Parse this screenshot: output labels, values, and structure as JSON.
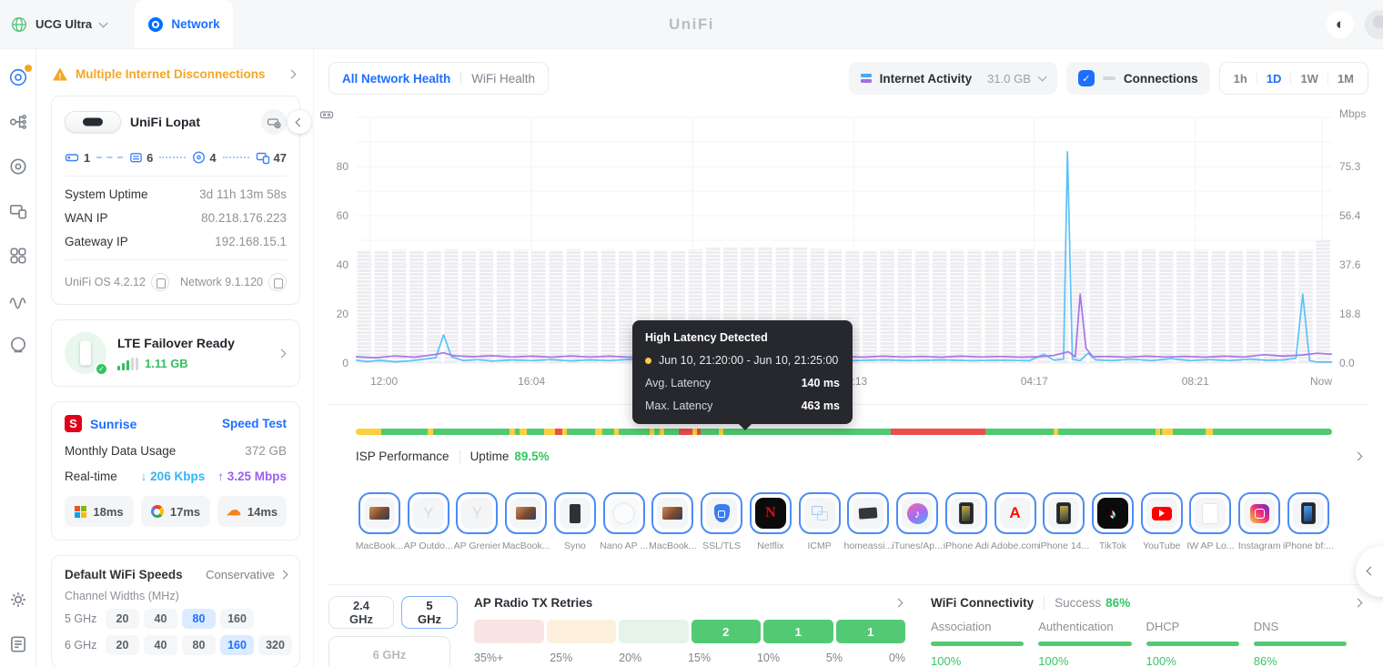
{
  "topbar": {
    "console_name": "UCG Ultra",
    "tab_label": "Network",
    "brand": "UniFi"
  },
  "sidebar": {
    "items": [
      "dashboard",
      "topology",
      "unifi-devices",
      "clients",
      "applications",
      "statistics",
      "radios",
      "settings",
      "system-log"
    ]
  },
  "left_panel": {
    "alert_label": "Multiple Internet Disconnections",
    "gateway_card": {
      "name": "UniFi Lopat",
      "topology": [
        {
          "type": "gateway",
          "count": "1"
        },
        {
          "type": "switch",
          "count": "6"
        },
        {
          "type": "access-point",
          "count": "4"
        },
        {
          "type": "clients",
          "count": "47"
        }
      ],
      "info_rows": [
        {
          "label": "System Uptime",
          "value": "3d 11h 13m 58s"
        },
        {
          "label": "WAN IP",
          "value": "80.218.176.223"
        },
        {
          "label": "Gateway IP",
          "value": "192.168.15.1"
        }
      ],
      "firmware": [
        {
          "label": "UniFi OS 4.2.12"
        },
        {
          "label": "Network 9.1.120"
        }
      ]
    },
    "lte_card": {
      "title": "LTE Failover Ready",
      "usage": "1.11 GB"
    },
    "isp_card": {
      "provider": "Sunrise",
      "speed_test_label": "Speed Test",
      "usage_label": "Monthly Data Usage",
      "usage_value": "372 GB",
      "realtime_label": "Real-time",
      "download": "206 Kbps",
      "upload": "3.25 Mbps",
      "pings": [
        {
          "provider": "Microsoft",
          "latency": "18ms"
        },
        {
          "provider": "Google",
          "latency": "17ms"
        },
        {
          "provider": "Cloudflare",
          "latency": "14ms"
        }
      ]
    },
    "wifi_card": {
      "title": "Default WiFi Speeds",
      "mode": "Conservative",
      "subtitle": "Channel Widths (MHz)",
      "rows": [
        {
          "band": "5 GHz",
          "options": [
            "20",
            "40",
            "80",
            "160"
          ],
          "selected": "80"
        },
        {
          "band": "6 GHz",
          "options": [
            "20",
            "40",
            "80",
            "160",
            "320"
          ],
          "selected": "160"
        }
      ]
    }
  },
  "main": {
    "health_tabs": [
      {
        "label": "All Network Health",
        "active": true
      },
      {
        "label": "WiFi Health",
        "active": false
      }
    ],
    "activity": {
      "label": "Internet Activity",
      "value": "31.0 GB"
    },
    "connections_label": "Connections",
    "ranges": [
      {
        "label": "1h"
      },
      {
        "label": "1D",
        "active": true
      },
      {
        "label": "1W"
      },
      {
        "label": "1M"
      }
    ],
    "tooltip": {
      "title": "High Latency Detected",
      "period": "Jun 10, 21:20:00 - Jun 10, 21:25:00",
      "rows": [
        {
          "label": "Avg. Latency",
          "value": "140 ms"
        },
        {
          "label": "Max. Latency",
          "value": "463 ms"
        }
      ]
    },
    "isp": {
      "label": "ISP Performance",
      "uptime_label": "Uptime",
      "uptime_value": "89.5%",
      "colors": {
        "g": "#4ecb71",
        "y": "#fccf3e",
        "r": "#ee4d4d"
      },
      "segments": [
        [
          "y",
          29
        ],
        [
          "g",
          52
        ],
        [
          "y",
          7
        ],
        [
          "g",
          86
        ],
        [
          "y",
          6
        ],
        [
          "g",
          6
        ],
        [
          "y",
          8
        ],
        [
          "g",
          19
        ],
        [
          "y",
          13
        ],
        [
          "r",
          8
        ],
        [
          "y",
          5
        ],
        [
          "g",
          32
        ],
        [
          "y",
          8
        ],
        [
          "g",
          14
        ],
        [
          "y",
          5
        ],
        [
          "g",
          35
        ],
        [
          "y",
          5
        ],
        [
          "g",
          6
        ],
        [
          "y",
          5
        ],
        [
          "g",
          17
        ],
        [
          "r",
          15
        ],
        [
          "y",
          5
        ],
        [
          "r",
          5
        ],
        [
          "g",
          20
        ],
        [
          "y",
          5
        ],
        [
          "g",
          190
        ],
        [
          "r",
          107
        ],
        [
          "g",
          78
        ],
        [
          "y",
          5
        ],
        [
          "g",
          110
        ],
        [
          "y",
          5
        ],
        [
          "g",
          2
        ],
        [
          "y",
          13
        ],
        [
          "g",
          37
        ],
        [
          "y",
          8
        ],
        [
          "g",
          135
        ]
      ]
    },
    "clients": [
      {
        "name": "MacBook...",
        "type": "laptop"
      },
      {
        "name": "AP Outdo...",
        "type": "antenna"
      },
      {
        "name": "AP Grenier",
        "type": "antenna"
      },
      {
        "name": "MacBook...",
        "type": "laptop"
      },
      {
        "name": "Syno",
        "type": "nas"
      },
      {
        "name": "Nano AP ...",
        "type": "ap-nano"
      },
      {
        "name": "MacBook...",
        "type": "laptop"
      },
      {
        "name": "SSL/TLS",
        "type": "shield"
      },
      {
        "name": "Netflix",
        "type": "netflix"
      },
      {
        "name": "ICMP",
        "type": "icmp"
      },
      {
        "name": "homeassi...",
        "type": "speaker"
      },
      {
        "name": "iTunes/Ap...",
        "type": "itunes"
      },
      {
        "name": "iPhone Adi",
        "type": "iphone"
      },
      {
        "name": "Adobe.com",
        "type": "adobe"
      },
      {
        "name": "iPhone 14...",
        "type": "iphone"
      },
      {
        "name": "TikTok",
        "type": "tiktok"
      },
      {
        "name": "YouTube",
        "type": "youtube"
      },
      {
        "name": "IW AP Lo...",
        "type": "ap-white"
      },
      {
        "name": "Instagram",
        "type": "instagram"
      },
      {
        "name": "iPhone bf:...",
        "type": "iphone-blue"
      }
    ],
    "bands": [
      {
        "label": "2.4 GHz"
      },
      {
        "label": "5 GHz",
        "active": true
      },
      {
        "label": "6 GHz",
        "disabled": true
      }
    ],
    "tx_retries": {
      "title": "AP Radio TX Retries",
      "buckets": [
        {
          "tone": "red",
          "count": ""
        },
        {
          "tone": "orange",
          "count": ""
        },
        {
          "tone": "green-light",
          "count": ""
        },
        {
          "tone": "green",
          "count": "2"
        },
        {
          "tone": "green",
          "count": "1"
        },
        {
          "tone": "green",
          "count": "1"
        }
      ],
      "scale": [
        "35%+",
        "25%",
        "20%",
        "15%",
        "10%",
        "5%",
        "0%"
      ]
    },
    "wifi_connectivity": {
      "title": "WiFi Connectivity",
      "success_label": "Success",
      "success_value": "86%",
      "columns": [
        {
          "label": "Association",
          "value": "100%"
        },
        {
          "label": "Authentication",
          "value": "100%"
        },
        {
          "label": "DHCP",
          "value": "100%"
        },
        {
          "label": "DNS",
          "value": "86%"
        }
      ]
    }
  },
  "chart_data": {
    "type": "line",
    "title": "Internet Activity",
    "left_axis_ticks": [
      80,
      60,
      40,
      20,
      0
    ],
    "right_axis": {
      "label": "Mbps",
      "ticks": [
        "75.3",
        "56.4",
        "37.6",
        "18.8",
        "0.0"
      ]
    },
    "x_ticks": [
      {
        "label": "12:00",
        "pos": 0.015
      },
      {
        "label": "16:04",
        "pos": 0.18
      },
      {
        "label": "00:13",
        "pos": 0.51
      },
      {
        "label": "04:17",
        "pos": 0.695
      },
      {
        "label": "08:21",
        "pos": 0.86
      },
      {
        "label": "Now",
        "pos": 0.99
      }
    ],
    "x_gridlines": [
      0.015,
      0.18,
      0.345,
      0.51,
      0.695,
      0.86,
      0.99
    ],
    "series": [
      {
        "name": "Download",
        "color": "#5ac2f7",
        "points": [
          [
            0,
            1.2
          ],
          [
            0.012,
            0.6
          ],
          [
            0.025,
            1.1
          ],
          [
            0.04,
            0.5
          ],
          [
            0.055,
            0.9
          ],
          [
            0.07,
            1.6
          ],
          [
            0.082,
            2.2
          ],
          [
            0.09,
            11.5
          ],
          [
            0.098,
            2.6
          ],
          [
            0.11,
            1
          ],
          [
            0.125,
            1.4
          ],
          [
            0.14,
            0.8
          ],
          [
            0.16,
            1.3
          ],
          [
            0.18,
            1
          ],
          [
            0.2,
            1.4
          ],
          [
            0.22,
            0.9
          ],
          [
            0.24,
            1.3
          ],
          [
            0.26,
            1
          ],
          [
            0.28,
            1.5
          ],
          [
            0.3,
            1
          ],
          [
            0.33,
            1.2
          ],
          [
            0.36,
            1.4
          ],
          [
            0.39,
            1
          ],
          [
            0.42,
            1.3
          ],
          [
            0.45,
            1
          ],
          [
            0.48,
            1.4
          ],
          [
            0.51,
            1
          ],
          [
            0.54,
            1.3
          ],
          [
            0.57,
            1
          ],
          [
            0.6,
            1.3
          ],
          [
            0.63,
            1
          ],
          [
            0.66,
            1.2
          ],
          [
            0.69,
            1
          ],
          [
            0.705,
            3.6
          ],
          [
            0.715,
            1.2
          ],
          [
            0.725,
            1.6
          ],
          [
            0.729,
            86
          ],
          [
            0.734,
            1.6
          ],
          [
            0.742,
            1
          ],
          [
            0.75,
            4
          ],
          [
            0.758,
            1.3
          ],
          [
            0.775,
            1
          ],
          [
            0.795,
            1.6
          ],
          [
            0.815,
            1
          ],
          [
            0.835,
            1.8
          ],
          [
            0.855,
            1
          ],
          [
            0.875,
            1.4
          ],
          [
            0.895,
            1
          ],
          [
            0.915,
            1.6
          ],
          [
            0.935,
            1.1
          ],
          [
            0.95,
            1.3
          ],
          [
            0.963,
            2
          ],
          [
            0.97,
            28
          ],
          [
            0.977,
            1
          ],
          [
            0.985,
            0.4
          ],
          [
            1,
            0.4
          ]
        ]
      },
      {
        "name": "Upload",
        "color": "#a873ea",
        "points": [
          [
            0,
            2.6
          ],
          [
            0.02,
            2.2
          ],
          [
            0.04,
            2.9
          ],
          [
            0.06,
            2.4
          ],
          [
            0.08,
            3.4
          ],
          [
            0.09,
            4.2
          ],
          [
            0.1,
            3
          ],
          [
            0.12,
            2.6
          ],
          [
            0.14,
            3
          ],
          [
            0.16,
            2.5
          ],
          [
            0.18,
            2.8
          ],
          [
            0.2,
            2.4
          ],
          [
            0.22,
            2.9
          ],
          [
            0.24,
            2.5
          ],
          [
            0.26,
            2.8
          ],
          [
            0.28,
            2.4
          ],
          [
            0.3,
            2.7
          ],
          [
            0.32,
            2.5
          ],
          [
            0.34,
            2.9
          ],
          [
            0.36,
            2.5
          ],
          [
            0.38,
            2.8
          ],
          [
            0.4,
            2.5
          ],
          [
            0.42,
            2.7
          ],
          [
            0.44,
            2.4
          ],
          [
            0.46,
            2.8
          ],
          [
            0.48,
            2.5
          ],
          [
            0.5,
            2.7
          ],
          [
            0.52,
            2.4
          ],
          [
            0.54,
            2.8
          ],
          [
            0.56,
            2.5
          ],
          [
            0.58,
            2.7
          ],
          [
            0.6,
            2.4
          ],
          [
            0.62,
            2.8
          ],
          [
            0.64,
            2.5
          ],
          [
            0.66,
            2.7
          ],
          [
            0.68,
            2.4
          ],
          [
            0.7,
            2.6
          ],
          [
            0.715,
            3.1
          ],
          [
            0.73,
            4.6
          ],
          [
            0.737,
            2.5
          ],
          [
            0.742,
            28
          ],
          [
            0.748,
            6
          ],
          [
            0.755,
            2.6
          ],
          [
            0.77,
            2.7
          ],
          [
            0.79,
            2.4
          ],
          [
            0.81,
            2.8
          ],
          [
            0.83,
            2.5
          ],
          [
            0.85,
            2.7
          ],
          [
            0.87,
            2.4
          ],
          [
            0.89,
            2.8
          ],
          [
            0.91,
            2.5
          ],
          [
            0.93,
            3.4
          ],
          [
            0.95,
            2.8
          ],
          [
            0.97,
            3.3
          ],
          [
            0.985,
            4
          ],
          [
            1,
            3.6
          ]
        ]
      }
    ],
    "connections": {
      "color": "#ededf1",
      "values": [
        46,
        45.5,
        46.2,
        45.8,
        46,
        46.3,
        45.7,
        46.1,
        45.9,
        46.2,
        45.8,
        46,
        46.4,
        45.9,
        46.1,
        45.8,
        46.2,
        46,
        45.8,
        46.3,
        47,
        47.4,
        47.2,
        47.5,
        47.3,
        47,
        46.6,
        46.2,
        46,
        45.8,
        46.1,
        46.3,
        46,
        45.8,
        46.1,
        46.2,
        45.9,
        46.1,
        46.3,
        46,
        45.9,
        46.2,
        46,
        45.8,
        46.1,
        46.3,
        46,
        45.9,
        46.2,
        46,
        45.9,
        46.2,
        46.1,
        45.9,
        46.2,
        50
      ]
    },
    "event": {
      "label": "High Latency Detected",
      "period": "Jun 10, 21:20:00 - Jun 10, 21:25:00",
      "avg_latency_ms": 140,
      "max_latency_ms": 463
    }
  }
}
